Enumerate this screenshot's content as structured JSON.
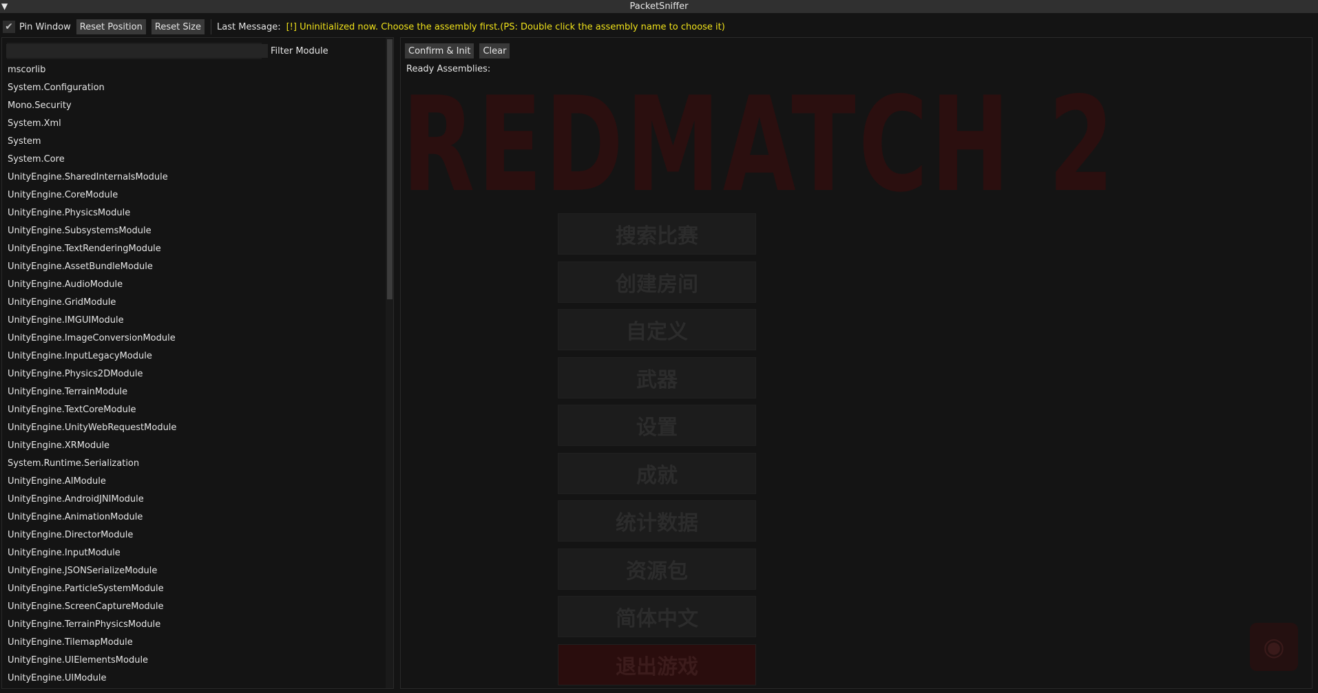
{
  "titlebar": {
    "title": "PacketSniffer",
    "toggle_icon": "triangle-down"
  },
  "toolbar": {
    "pin_window": {
      "label": "Pin Window",
      "checked": true
    },
    "reset_position_label": "Reset Position",
    "reset_size_label": "Reset Size",
    "last_message_label": "Last Message:",
    "last_message_text": "[!] Uninitialized now. Choose the assembly first.(PS: Double click the assembly name to choose it)",
    "message_color": "#f0e21a"
  },
  "left": {
    "filter_value": "",
    "filter_label": "Filter Module",
    "modules": [
      "mscorlib",
      "System.Configuration",
      "Mono.Security",
      "System.Xml",
      "System",
      "System.Core",
      "UnityEngine.SharedInternalsModule",
      "UnityEngine.CoreModule",
      "UnityEngine.PhysicsModule",
      "UnityEngine.SubsystemsModule",
      "UnityEngine.TextRenderingModule",
      "UnityEngine.AssetBundleModule",
      "UnityEngine.AudioModule",
      "UnityEngine.GridModule",
      "UnityEngine.IMGUIModule",
      "UnityEngine.ImageConversionModule",
      "UnityEngine.InputLegacyModule",
      "UnityEngine.Physics2DModule",
      "UnityEngine.TerrainModule",
      "UnityEngine.TextCoreModule",
      "UnityEngine.UnityWebRequestModule",
      "UnityEngine.XRModule",
      "System.Runtime.Serialization",
      "UnityEngine.AIModule",
      "UnityEngine.AndroidJNIModule",
      "UnityEngine.AnimationModule",
      "UnityEngine.DirectorModule",
      "UnityEngine.InputModule",
      "UnityEngine.JSONSerializeModule",
      "UnityEngine.ParticleSystemModule",
      "UnityEngine.ScreenCaptureModule",
      "UnityEngine.TerrainPhysicsModule",
      "UnityEngine.TilemapModule",
      "UnityEngine.UIElementsModule",
      "UnityEngine.UIModule"
    ]
  },
  "right": {
    "confirm_label": "Confirm & Init",
    "clear_label": "Clear",
    "ready_label": "Ready Assemblies:"
  },
  "background": {
    "game_title": "REDMATCH 2",
    "menu": [
      "搜索比赛",
      "创建房间",
      "自定义",
      "武器",
      "设置",
      "成就",
      "统计数据",
      "资源包",
      "简体中文",
      "退出游戏"
    ]
  }
}
